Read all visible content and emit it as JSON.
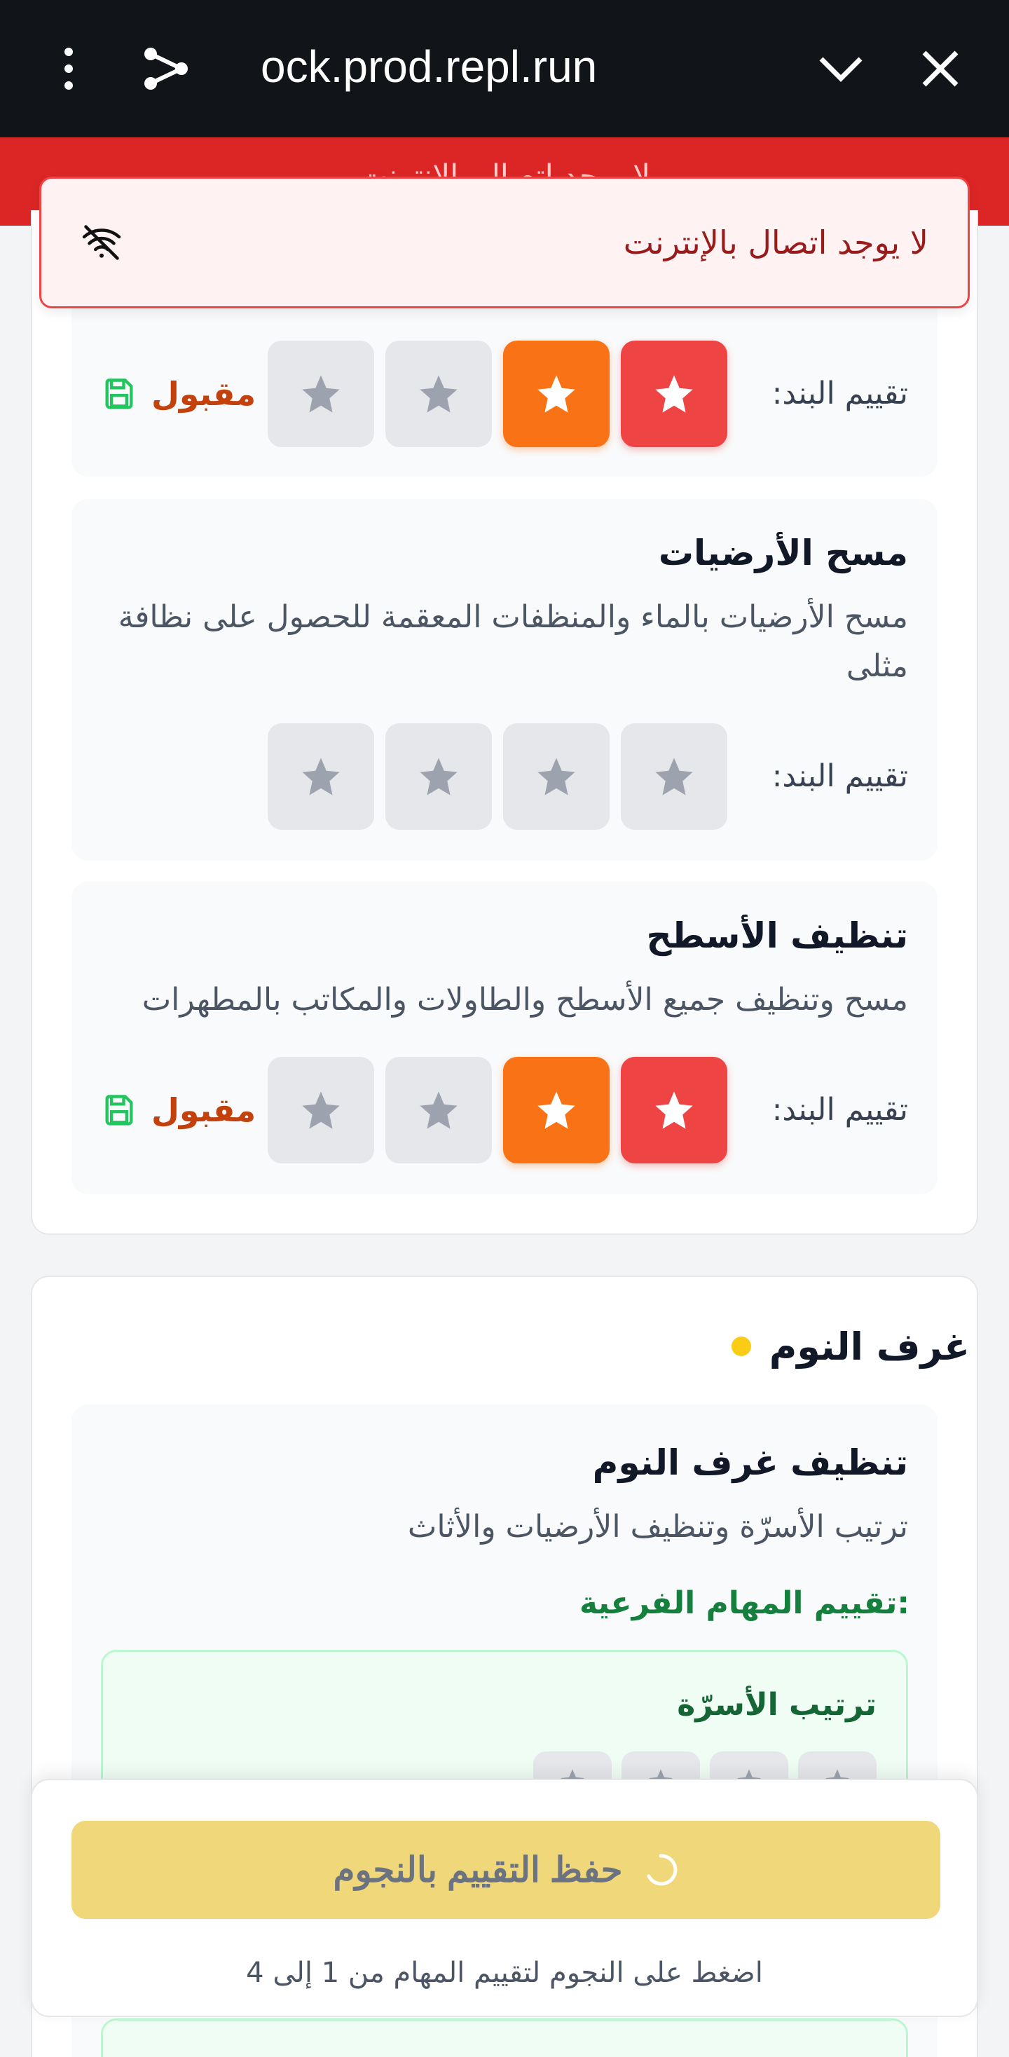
{
  "browser": {
    "url": "ock.prod.repl.run"
  },
  "offline_strip": {
    "text": "لا يوجد اتصال بالإنترنت"
  },
  "alert": {
    "message": "لا يوجد اتصال بالإنترنت",
    "icon": "wifi-off-icon"
  },
  "colors": {
    "accent_red": "#ef4444",
    "accent_orange": "#f97316",
    "inactive_star": "#e5e7eb",
    "status_text": "#c2410c",
    "save_button": "#f0d87a",
    "subtask_green": "#15803d"
  },
  "first_section": {
    "tasks": [
      {
        "title": "",
        "rating_label": "تقييم البند:",
        "rating": 2,
        "status": "مقبول"
      },
      {
        "title": "مسح الأرضيات",
        "description": "مسح الأرضيات بالماء والمنظفات المعقمة للحصول على نظافة مثلى",
        "rating_label": "تقييم البند:",
        "rating": 0
      },
      {
        "title": "تنظيف الأسطح",
        "description": "مسح وتنظيف جميع الأسطح والطاولات والمكاتب بالمطهرات",
        "rating_label": "تقييم البند:",
        "rating": 2,
        "status": "مقبول"
      }
    ]
  },
  "bedrooms_section": {
    "title": "غرف النوم",
    "task": {
      "title": "تنظيف غرف النوم",
      "description": "ترتيب الأسرّة وتنظيف الأرضيات والأثاث"
    },
    "subtasks_heading": "تقييم المهام الفرعية:",
    "subtasks": [
      {
        "title": "ترتيب الأسرّة"
      }
    ]
  },
  "footer": {
    "save_label": "حفظ التقييم بالنجوم",
    "hint": "اضغط على النجوم لتقييم المهام من 1 إلى 4"
  }
}
